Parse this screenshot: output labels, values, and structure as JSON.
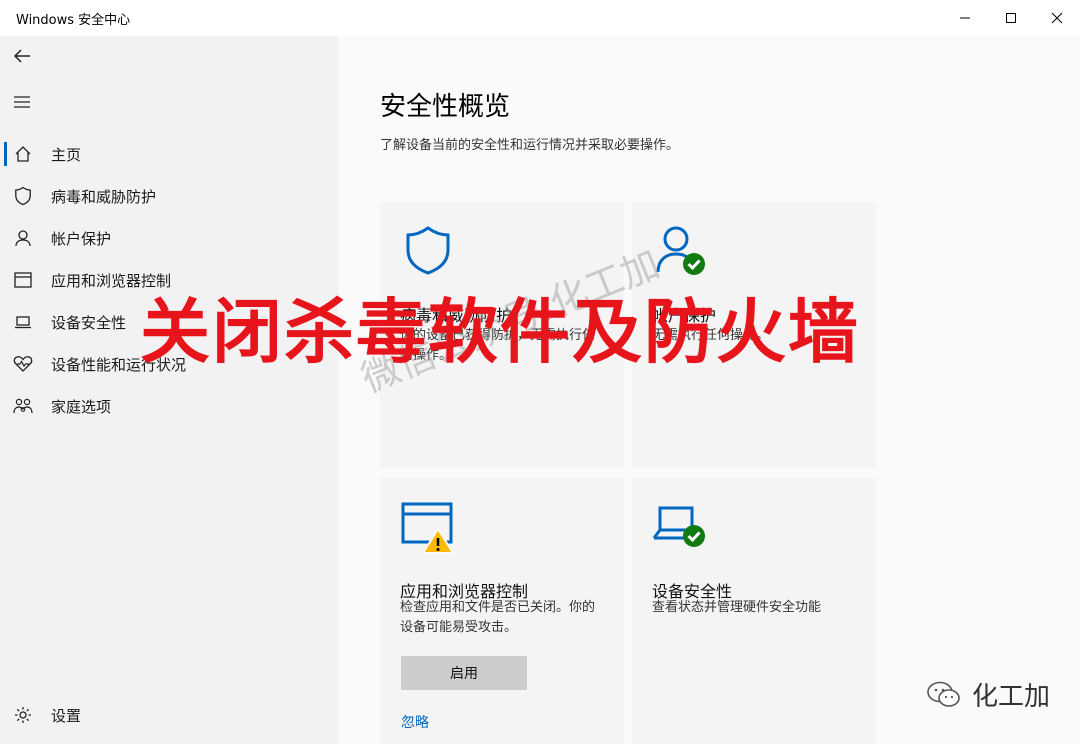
{
  "window": {
    "title": "Windows 安全中心"
  },
  "sidebar": {
    "items": [
      {
        "label": "主页",
        "icon": "home-icon"
      },
      {
        "label": "病毒和威胁防护",
        "icon": "shield-icon"
      },
      {
        "label": "帐户保护",
        "icon": "person-icon"
      },
      {
        "label": "应用和浏览器控制",
        "icon": "browser-window-icon"
      },
      {
        "label": "设备安全性",
        "icon": "laptop-icon"
      },
      {
        "label": "设备性能和运行状况",
        "icon": "heart-pulse-icon"
      },
      {
        "label": "家庭选项",
        "icon": "family-icon"
      }
    ],
    "settings_label": "设置"
  },
  "main": {
    "title": "安全性概览",
    "description": "了解设备当前的安全性和运行情况并采取必要操作。",
    "cards": [
      {
        "title": "病毒和威胁防护",
        "desc": "你的设备已获得防护，无需执行任何操作。"
      },
      {
        "title": "帐户保护",
        "desc": "无需执行任何操作。"
      },
      {
        "title": "应用和浏览器控制",
        "desc": "检查应用和文件是否已关闭。你的设备可能易受攻击。",
        "button": "启用",
        "link": "忽略"
      },
      {
        "title": "设备安全性",
        "desc": "查看状态并管理硬件安全功能"
      }
    ]
  },
  "overlay": {
    "title": "关闭杀毒软件及防火墙",
    "watermark": "微信公众号:化工加",
    "brand": "化工加"
  },
  "colors": {
    "accent": "#0067c0",
    "ok": "#107c10",
    "warning": "#ffb900",
    "overlay_red": "#e8141c"
  }
}
